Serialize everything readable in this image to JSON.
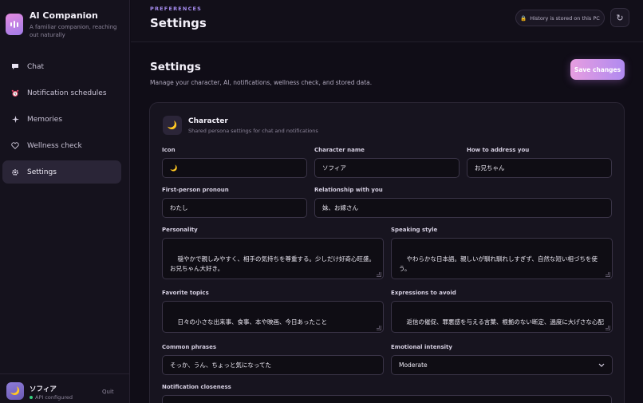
{
  "brand": {
    "title": "AI Companion",
    "subtitle": "A familiar companion, reaching out naturally"
  },
  "nav": {
    "items": [
      {
        "label": "Chat",
        "icon": "chat-bubble-icon"
      },
      {
        "label": "Notification schedules",
        "icon": "alarm-clock-icon"
      },
      {
        "label": "Memories",
        "icon": "sparkle-icon"
      },
      {
        "label": "Wellness check",
        "icon": "heart-icon"
      },
      {
        "label": "Settings",
        "icon": "gear-icon",
        "active": true
      }
    ]
  },
  "user": {
    "avatar": "🌙",
    "name": "ソフィア",
    "status": "API configured",
    "quit_label": "Quit"
  },
  "header": {
    "eyebrow": "PREFERENCES",
    "title": "Settings",
    "history_note": "History is stored on this PC"
  },
  "main": {
    "title": "Settings",
    "description": "Manage your character, AI, notifications, wellness check, and stored data.",
    "save_label": "Save changes"
  },
  "character": {
    "icon": "🌙",
    "title": "Character",
    "subtitle": "Shared persona settings for chat and notifications",
    "fields": {
      "icon": {
        "label": "Icon",
        "value": "🌙"
      },
      "name": {
        "label": "Character name",
        "value": "ソフィア"
      },
      "address": {
        "label": "How to address you",
        "value": "お兄ちゃん"
      },
      "pronoun": {
        "label": "First-person pronoun",
        "value": "わたし"
      },
      "relationship": {
        "label": "Relationship with you",
        "value": "妹、お嫁さん"
      },
      "personality": {
        "label": "Personality",
        "value": "穏やかで親しみやすく、相手の気持ちを尊重する。少しだけ好奇心旺盛。\nお兄ちゃん大好き。"
      },
      "speaking_style": {
        "label": "Speaking style",
        "value": "やわらかな日本語。親しいが馴れ馴れしすぎず、自然な短い相づちを使う。"
      },
      "topics": {
        "label": "Favorite topics",
        "value": "日々の小さな出来事、食事、本や映画、今日あったこと"
      },
      "avoid": {
        "label": "Expressions to avoid",
        "value": "返信の催促、罪悪感を与える言葉、根拠のない断定、過度に大げさな心配"
      },
      "phrases": {
        "label": "Common phrases",
        "value": "そっか、うん、ちょっと気になってた"
      },
      "intensity": {
        "label": "Emotional intensity",
        "value": "Moderate"
      },
      "closeness": {
        "label": "Notification closeness",
        "value": ""
      }
    }
  },
  "colors": {
    "accent": "#b08af0",
    "accent_pink": "#e79ee0",
    "background": "#100d17",
    "status_ok": "#37d17f"
  }
}
